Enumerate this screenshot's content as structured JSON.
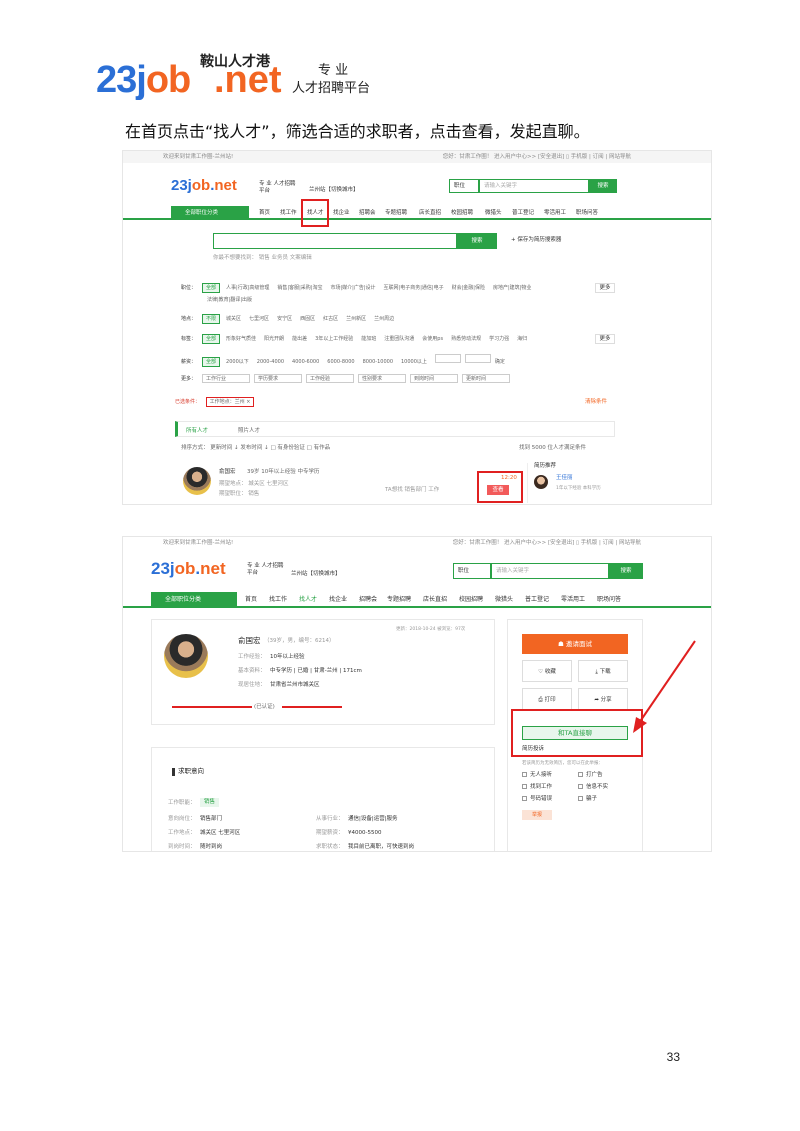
{
  "logo": {
    "num": "23j",
    "mid": "ob",
    "net": ".net",
    "cn_name": "鞍山人才港",
    "sub1": "专 业",
    "sub2": "人才招聘平台"
  },
  "instruction": "在首页点击“找人才”，筛选合适的求职者，点击查看，发起直聊。",
  "shot1": {
    "welcome": "欢迎来到甘肃工作圈-兰州站!",
    "top_right": "您好：甘肃工作圈！ 进入用户中心>> [安全退出] ▯ 手机版 | 订阅 | 网站导航",
    "mini_logo": "23job.net",
    "mini_sub": "专 业 人才招聘平台",
    "city": "兰州站【切换城市】",
    "search_select": "职位",
    "search_placeholder": "请输入关键字",
    "search_btn": "搜索",
    "nav_cat": "全部职位分类",
    "nav": [
      "首页",
      "找工作",
      "找人才",
      "找企业",
      "招聘会",
      "专题招聘",
      "店长直招",
      "校园招聘",
      "微猎头",
      "普工登记",
      "零活用工",
      "职场问答"
    ],
    "search2_btn": "搜索",
    "save_search": "+ 保存为简历搜索器",
    "hot_words": "你最不想要找到：  销售   业务员   文案编辑",
    "filters": {
      "job_label": "职位：",
      "job_sel": "全部",
      "job_opts": [
        "人事|行政|高级管理",
        "销售|客服|采购|淘宝",
        "市场|媒介|广告|设计",
        "互联网|电子商务|通信|电子",
        "财会|金融|保险",
        "房地产|建筑|物业"
      ],
      "job_opts2": "法律|教育|翻译|出版",
      "more": "更多",
      "area_label": "地点：",
      "area_sel": "不限",
      "area_opts": [
        "城关区",
        "七里河区",
        "安宁区",
        "西固区",
        "红古区",
        "兰州新区",
        "兰州周边"
      ],
      "tag_label": "标签：",
      "tag_sel": "全部",
      "tag_opts": [
        "形象好气质佳",
        "阳光开朗",
        "能出差",
        "3年以上工作经验",
        "能加班",
        "注重团队沟通",
        "会使用ps",
        "熟悉劳动法规",
        "学习力强",
        "海归"
      ],
      "salary_label": "薪资：",
      "salary_sel": "全部",
      "salary_opts": [
        "2000以下",
        "2000-4000",
        "4000-6000",
        "6000-8000",
        "8000-10000",
        "10000以上"
      ],
      "salary_ok": "确定",
      "more_label": "更多：",
      "drops": [
        "工作行业",
        "学历要求",
        "工作经验",
        "性别要求",
        "到岗时间",
        "更新时间"
      ],
      "selected_label": "已选条件：",
      "selected_tag": "工作地点：兰州 ×",
      "clear": "清除条件"
    },
    "tabs": {
      "all": "所有人才",
      "photo": "照片人才"
    },
    "sort": "排序方式：  更新时间 ↓   发布时间 ↓   □ 有身份验证   □ 有作品",
    "found": "找到 5000 位人才满足条件",
    "person": {
      "name": "俞国宏",
      "meta": "39岁  10年以上经验  中专学历",
      "line2": "期望地点：  城关区 七里河区",
      "line3": "期望职位：  销售",
      "desire": "TA想找 销售部门 工作",
      "time": "12:20",
      "view_btn": "查看"
    },
    "recommend": {
      "title": "简历推荐",
      "name": "王佳丽",
      "meta": "1年以下经验  本科学历"
    }
  },
  "shot2": {
    "welcome": "欢迎来到甘肃工作圈-兰州站!",
    "top_right": "您好：甘肃工作圈！ 进入用户中心>> [安全退出] ▯ 手机版 | 订阅 | 网站导航",
    "mini_logo": "23job.net",
    "mini_sub": "专 业 人才招聘平台",
    "city": "兰州站【切换城市】",
    "search_select": "职位",
    "search_placeholder": "请输入关键字",
    "search_btn": "搜索",
    "nav_cat": "全部职位分类",
    "nav": [
      "首页",
      "找工作",
      "找人才",
      "找企业",
      "招聘会",
      "专题招聘",
      "店长直招",
      "校园招聘",
      "微猎头",
      "普工登记",
      "零活用工",
      "职场问答"
    ],
    "resume": {
      "updated": "更新：2018-10-24   被浏览：97次",
      "name": "俞国宏",
      "meta": "（39岁，男，编号：6214）",
      "exp_label": "工作经验：",
      "exp": "10年以上经验",
      "basic_label": "基本资料：",
      "basic": "中专学历  |  已婚  |  甘肃-兰州  |  171cm",
      "addr_label": "现居住地：",
      "addr": "甘肃省兰州市城关区",
      "verified": "(已认证)"
    },
    "intent": {
      "title": "求职意向",
      "job_label": "工作职能：",
      "job": "销售",
      "pos_label": "意向岗位：",
      "pos": "销售部门",
      "loc_label": "工作地点：",
      "loc": "城关区 七里河区",
      "ind_label": "从事行业：",
      "ind": "通信|设备|运营|服务",
      "sal_label": "期望薪资：",
      "sal": "¥4000-5500",
      "arr_label": "到岗时间：",
      "arr": "随时到岗",
      "st_label": "求职状态：",
      "st": "我目前已离职，可快速到岗"
    },
    "side": {
      "invite": "邀请面试",
      "fav": "收藏",
      "download": "下载",
      "print": "打印",
      "share": "分享",
      "chat": "和TA直接聊",
      "report_title": "简历投诉",
      "report_desc": "若该简历为无效简历，您可以在此举报：",
      "reasons": [
        "无人接听",
        "打广告",
        "找到工作",
        "信息不实",
        "号码错误",
        "骗子"
      ],
      "report_btn": "举报"
    }
  },
  "page_number": "33",
  "colors": {
    "brand_green": "#2aa246",
    "brand_orange": "#f26522",
    "brand_blue": "#2b6fd6",
    "highlight_red": "#e02020"
  }
}
